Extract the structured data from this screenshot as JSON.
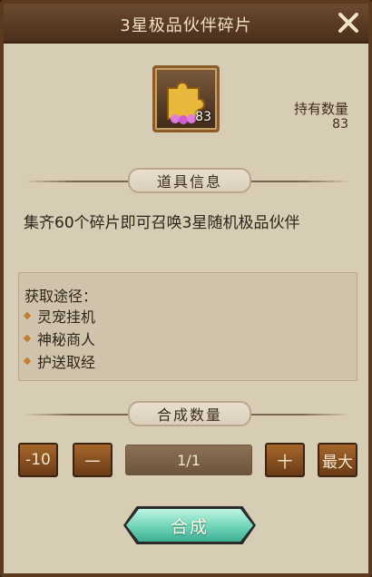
{
  "window": {
    "title": "3星极品伙伴碎片"
  },
  "item": {
    "icon": "puzzle-piece-icon",
    "count": "83"
  },
  "holding": {
    "label": "持有数量",
    "value": "83"
  },
  "item_info": {
    "section_label": "道具信息",
    "description": "集齐60个碎片即可召唤3星随机极品伙伴"
  },
  "sources": {
    "title": "获取途径：",
    "items": [
      "灵宠挂机",
      "神秘商人",
      "护送取经"
    ]
  },
  "quantity": {
    "section_label": "合成数量",
    "minus10_label": "-10",
    "minus_label": "一",
    "value": "1/1",
    "plus_label": "十",
    "max_label": "最大"
  },
  "compose_button": {
    "label": "合成"
  },
  "colors": {
    "accent": "#6fd4b8",
    "frame": "#5c3a1e",
    "panel": "#d7ccb4"
  }
}
